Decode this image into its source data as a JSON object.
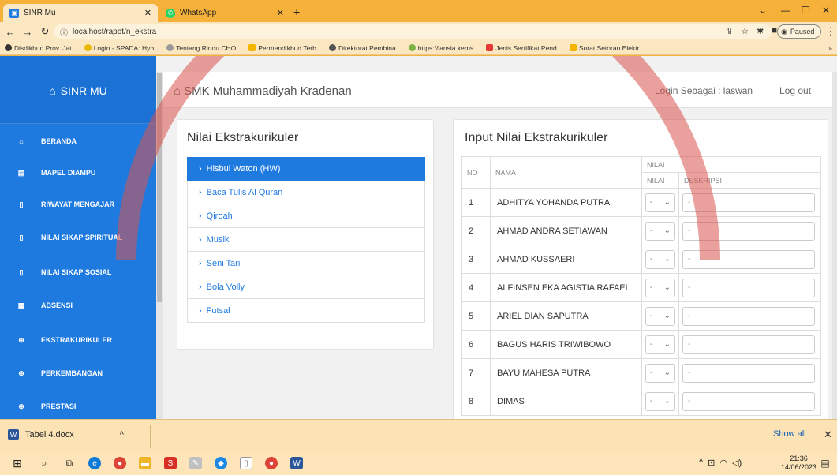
{
  "browser": {
    "tabs": [
      {
        "title": "SINR Mu",
        "icon": "sinr-favicon-icon",
        "active": true
      },
      {
        "title": "WhatsApp",
        "icon": "whatsapp-icon",
        "active": false
      }
    ],
    "url": "localhost/rapot/n_ekstra",
    "paused_label": "Paused",
    "bookmarks": [
      "Disdikbud Prov. Jat...",
      "Login - SPADA: Hyb...",
      "Tentang Rindu CHO...",
      "Permendikbud Terb...",
      "Direktorat Pembina...",
      "https://lansia.kems...",
      "Jenis Sertifikat Pend...",
      "Surat Setoran Elektr..."
    ]
  },
  "sidebar": {
    "brand": "SINR MU",
    "items": [
      {
        "label": "BERANDA",
        "icon": "home-icon"
      },
      {
        "label": "MAPEL DIAMPU",
        "icon": "book-icon"
      },
      {
        "label": "RIWAYAT MENGAJAR",
        "icon": "document-icon"
      },
      {
        "label": "NILAI SIKAP SPIRITUAL",
        "icon": "document-icon"
      },
      {
        "label": "NILAI SIKAP SOSIAL",
        "icon": "document-icon"
      },
      {
        "label": "ABSENSI",
        "icon": "calendar-icon"
      },
      {
        "label": "EKSTRAKURIKULER",
        "icon": "globe-icon"
      },
      {
        "label": "PERKEMBANGAN",
        "icon": "globe-icon"
      },
      {
        "label": "PRESTASI",
        "icon": "globe-icon"
      }
    ]
  },
  "header": {
    "school": "SMK Muhammadiyah Kradenan",
    "login_as": "Login Sebagai : laswan",
    "logout": "Log out"
  },
  "ekstra_panel": {
    "title": "Nilai Ekstrakurikuler",
    "items": [
      {
        "label": "Hisbul Waton (HW)",
        "active": true
      },
      {
        "label": "Baca Tulis Al Quran",
        "active": false
      },
      {
        "label": "Qiroah",
        "active": false
      },
      {
        "label": "Musik",
        "active": false
      },
      {
        "label": "Seni Tari",
        "active": false
      },
      {
        "label": "Bola Volly",
        "active": false
      },
      {
        "label": "Futsal",
        "active": false
      }
    ]
  },
  "input_panel": {
    "title": "Input Nilai Ekstrakurikuler",
    "columns": {
      "no": "NO",
      "nama": "NAMA",
      "nilai_group": "NILAI",
      "nilai": "NILAI",
      "deskripsi": "DESKRIPSI"
    },
    "select_value": "-",
    "desc_placeholder": "-",
    "rows": [
      {
        "no": "1",
        "nama": "ADHITYA YOHANDA PUTRA"
      },
      {
        "no": "2",
        "nama": "AHMAD ANDRA SETIAWAN"
      },
      {
        "no": "3",
        "nama": "AHMAD KUSSAERI"
      },
      {
        "no": "4",
        "nama": "ALFINSEN EKA AGISTIA RAFAEL"
      },
      {
        "no": "5",
        "nama": "ARIEL DIAN SAPUTRA"
      },
      {
        "no": "6",
        "nama": "BAGUS HARIS TRIWIBOWO"
      },
      {
        "no": "7",
        "nama": "BAYU MAHESA PUTRA"
      },
      {
        "no": "8",
        "nama": "DIMAS"
      }
    ]
  },
  "download_bar": {
    "file": "Tabel 4.docx",
    "show_all": "Show all"
  },
  "taskbar": {
    "time": "21:36",
    "date": "14/06/2023"
  },
  "colors": {
    "primary": "#1f7ae0",
    "browser_frame": "#f5b13a"
  }
}
